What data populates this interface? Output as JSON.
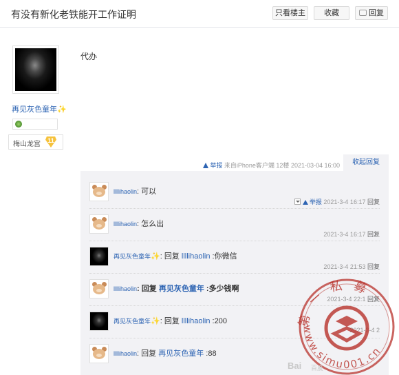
{
  "header": {
    "title": "有没有新化老铁能开工作证明",
    "only_lz_label": "只看楼主",
    "favorite_label": "收藏",
    "reply_label": "回复"
  },
  "author": {
    "name": "再见灰色童年",
    "sparkle": "✨",
    "forum_level_name": "梅山龙宫",
    "forum_level": "11"
  },
  "post": {
    "content": "代办",
    "report_label": "举报",
    "source": "来自iPhone客户端",
    "floor": "12楼",
    "time": "2021-03-04 16:00",
    "collapse_label": "收起回复"
  },
  "replies": [
    {
      "user": "llllihaolin",
      "sparkle": "",
      "prefix": "",
      "target": "",
      "sep": ":",
      "text": "可以",
      "bold": false,
      "time": "2021-3-4 16:17",
      "reply_label": "回复",
      "report_label": "举报",
      "show_report": true,
      "avatar": "bear"
    },
    {
      "user": "llllihaolin",
      "sparkle": "",
      "prefix": "",
      "target": "",
      "sep": ":",
      "text": "怎么出",
      "bold": false,
      "time": "2021-3-4 16:17",
      "reply_label": "回复",
      "report_label": "",
      "show_report": false,
      "avatar": "bear"
    },
    {
      "user": "再见灰色童年",
      "sparkle": "✨",
      "prefix": "回复",
      "target": "llllihaolin",
      "sep": " :",
      "text": "你微信",
      "bold": false,
      "time": "2021-3-4 21:53",
      "reply_label": "回复",
      "report_label": "",
      "show_report": false,
      "avatar": "dark"
    },
    {
      "user": "llllihaolin",
      "sparkle": "",
      "prefix": "回复",
      "target": "再见灰色童年",
      "sep": " :",
      "text": "多少钱啊",
      "bold": true,
      "time": "2021-3-4 22:1",
      "reply_label": "回复",
      "report_label": "",
      "show_report": false,
      "avatar": "bear"
    },
    {
      "user": "再见灰色童年",
      "sparkle": "✨",
      "prefix": "回复",
      "target": "llllihaolin",
      "sep": " :",
      "text": "200",
      "bold": false,
      "time": "2021-3-4 2",
      "reply_label": "",
      "report_label": "",
      "show_report": false,
      "avatar": "dark"
    },
    {
      "user": "llllihaolin",
      "sparkle": "",
      "prefix": "回复",
      "target": "再见灰色童年",
      "sep": " :",
      "text": "88",
      "bold": false,
      "time": "",
      "reply_label": "",
      "report_label": "",
      "show_report": false,
      "avatar": "bear"
    }
  ],
  "watermark": {
    "top_text": "第一私募",
    "bottom_text": "www.simu001.cn",
    "baidu_text": "Bai",
    "baidu_sub": "百度"
  },
  "colors": {
    "link": "#2d64b3",
    "stamp": "#b8322b",
    "reply_bg": "#f2f2f5"
  }
}
